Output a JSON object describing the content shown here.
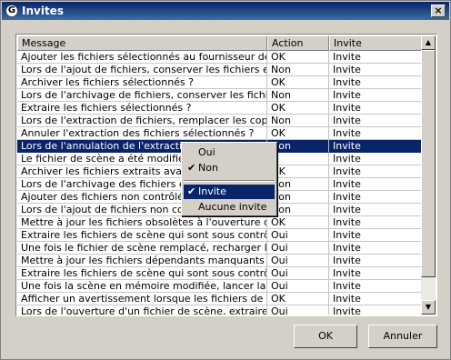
{
  "window": {
    "title": "Invites",
    "close_label": "×",
    "app_icon_label": "G"
  },
  "table": {
    "columns": [
      "Message",
      "Action",
      "Invite"
    ],
    "rows": [
      [
        "Ajouter les fichiers sélectionnés au fournisseur de sui...",
        "OK",
        "Invite"
      ],
      [
        "Lors de l'ajout de fichiers, conserver les fichiers extra...",
        "Non",
        "Invite"
      ],
      [
        "Archiver les fichiers sélectionnés ?",
        "OK",
        "Invite"
      ],
      [
        "Lors de l'archivage de fichiers, conserver les fichiers ...",
        "Non",
        "Invite"
      ],
      [
        "Extraire les fichiers sélectionnés ?",
        "OK",
        "Invite"
      ],
      [
        "Lors de l'extraction de fichiers, remplacer les copies l...",
        "Non",
        "Invite"
      ],
      [
        "Annuler l'extraction des fichiers sélectionnés ?",
        "OK",
        "Invite"
      ],
      [
        "Lors de l'annulation de l'extraction de",
        "Non",
        "Invite"
      ],
      [
        "Le fichier de scène a été modifié.  En",
        "",
        "Invite"
      ],
      [
        "Archiver les fichiers extraits avant d",
        "OK",
        "Invite"
      ],
      [
        "Lors de l'archivage des fichiers extra",
        "Non",
        "Invite"
      ],
      [
        "Ajouter des fichiers non contrôlés av",
        "Non",
        "Invite"
      ],
      [
        "Lors de l'ajout de fichiers non contrô",
        "Non",
        "Invite"
      ],
      [
        "Mettre à jour les fichiers obsolètes à l'ouverture de la...",
        "OK",
        "Invite"
      ],
      [
        "Extraire les fichiers de scène qui sont sous contrôle à...",
        "Oui",
        "Invite"
      ],
      [
        "Une fois le fichier de scène remplacé, recharger le no...",
        "Oui",
        "Invite"
      ],
      [
        "Mettre à jour les fichiers dépendants manquants ou o...",
        "Oui",
        "Invite"
      ],
      [
        "Extraire les fichiers de scène qui sont sous contrôle a...",
        "Oui",
        "Invite"
      ],
      [
        "Une fois la scène en mémoire modifiée, lancer la boîte...",
        "Oui",
        "Invite"
      ],
      [
        "Afficher un avertissement lorsque les fichiers de scèn...",
        "OK",
        "Invite"
      ],
      [
        "Lors de l'ouverture d'un fichier de scène, extraire les...",
        "Oui",
        "Invite"
      ]
    ],
    "selected_row": 7
  },
  "scrollbar": {
    "up": "▲",
    "down": "▼"
  },
  "context_menu": {
    "items": [
      {
        "label": "Oui",
        "checked": false
      },
      {
        "label": "Non",
        "checked": true
      },
      {
        "label": "Invite",
        "checked": true,
        "highlighted": true
      },
      {
        "label": "Aucune invite",
        "checked": false
      }
    ],
    "check_glyph": "✔"
  },
  "buttons": {
    "ok": "OK",
    "cancel": "Annuler"
  }
}
